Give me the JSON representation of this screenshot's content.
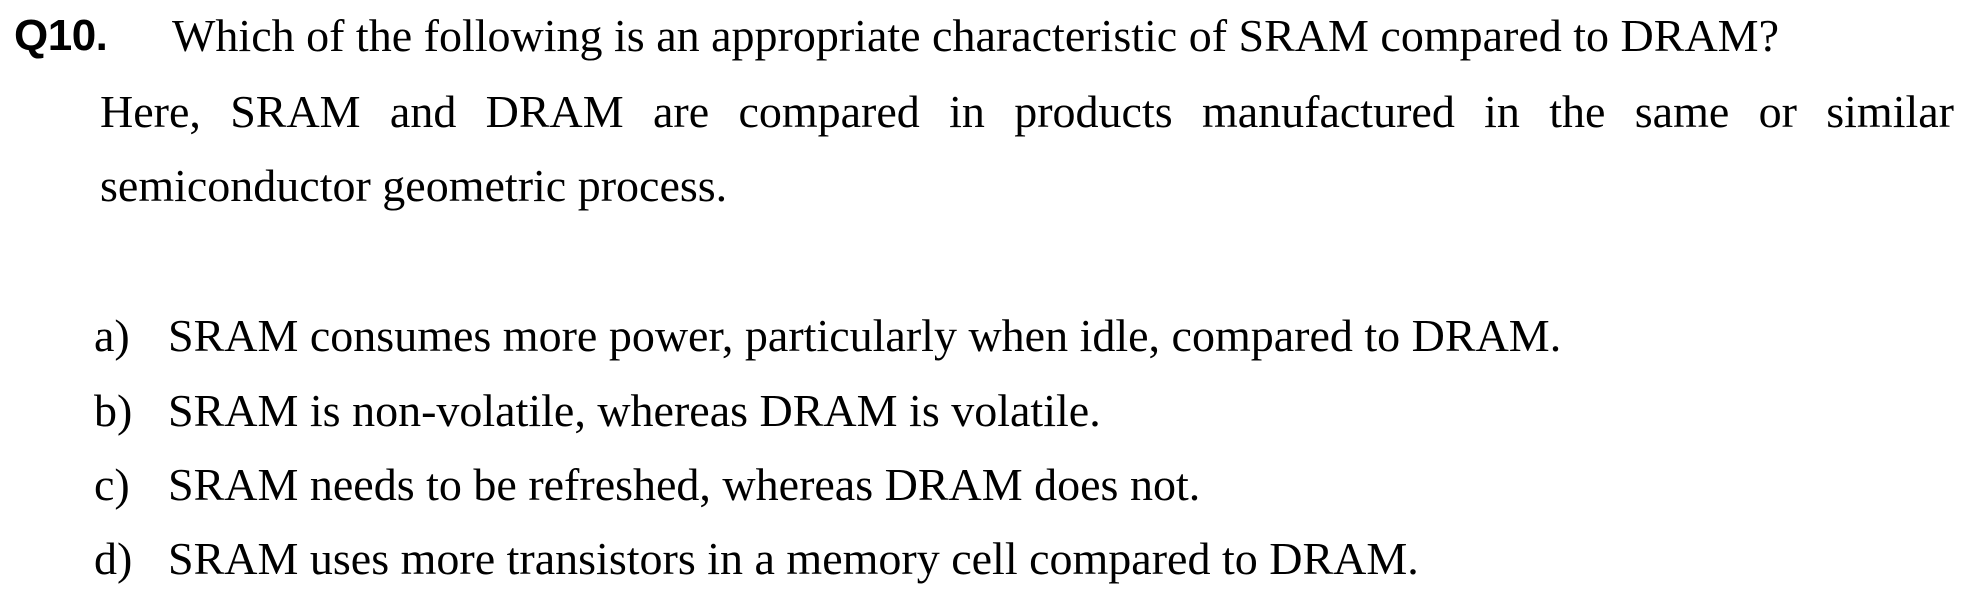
{
  "question": {
    "number": "Q10.",
    "line1": "Which of the following is an appropriate characteristic of SRAM compared to DRAM?",
    "line2": "Here, SRAM and DRAM are compared in products manufactured in the same or similar",
    "line3": "semiconductor geometric process."
  },
  "options": [
    {
      "letter": "a)",
      "text": "SRAM consumes more power, particularly when idle, compared to DRAM."
    },
    {
      "letter": "b)",
      "text": "SRAM is non-volatile, whereas DRAM is volatile."
    },
    {
      "letter": "c)",
      "text": "SRAM needs to be refreshed, whereas DRAM does not."
    },
    {
      "letter": "d)",
      "text": "SRAM uses more transistors in a memory cell compared to DRAM."
    }
  ]
}
